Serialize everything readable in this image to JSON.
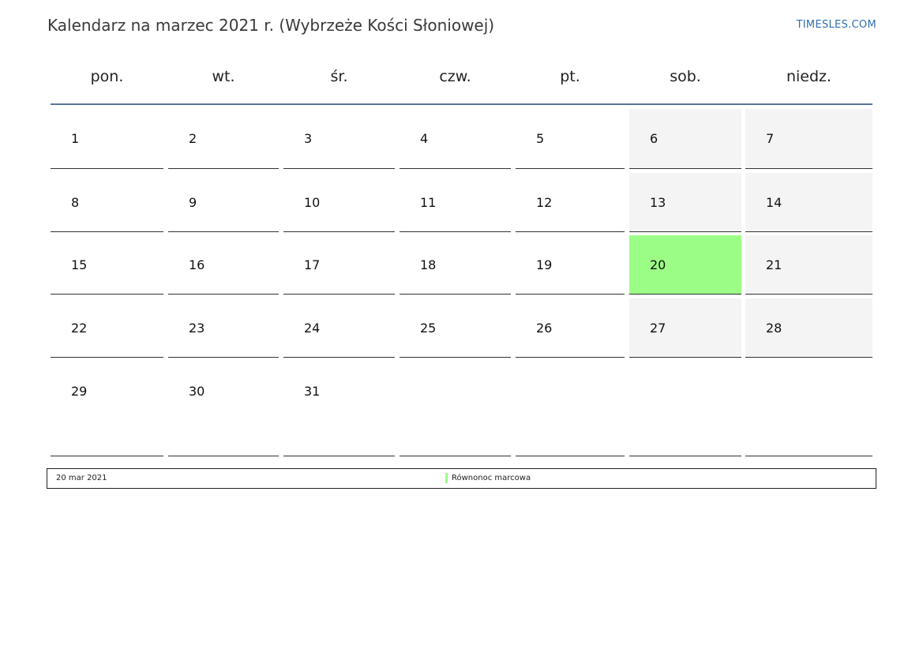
{
  "page": {
    "title": "Kalendarz na marzec 2021 r. (Wybrzeże Kości Słoniowej)",
    "brand": "TIMESLES.COM"
  },
  "colors": {
    "header_line": "#5a7499",
    "weekend_bg": "#f4f4f4",
    "holiday_bg": "#9cfd86",
    "brand": "#2f6fb0"
  },
  "weekdays": [
    "pon.",
    "wt.",
    "śr.",
    "czw.",
    "pt.",
    "sob.",
    "niedz."
  ],
  "weeks": [
    [
      "1",
      "2",
      "3",
      "4",
      "5",
      "6",
      "7"
    ],
    [
      "8",
      "9",
      "10",
      "11",
      "12",
      "13",
      "14"
    ],
    [
      "15",
      "16",
      "17",
      "18",
      "19",
      "20",
      "21"
    ],
    [
      "22",
      "23",
      "24",
      "25",
      "26",
      "27",
      "28"
    ],
    [
      "29",
      "30",
      "31",
      "",
      "",
      "",
      ""
    ]
  ],
  "holidays": [
    {
      "day": "20",
      "date": "20 mar 2021",
      "name": "Równonoc marcowa"
    }
  ]
}
